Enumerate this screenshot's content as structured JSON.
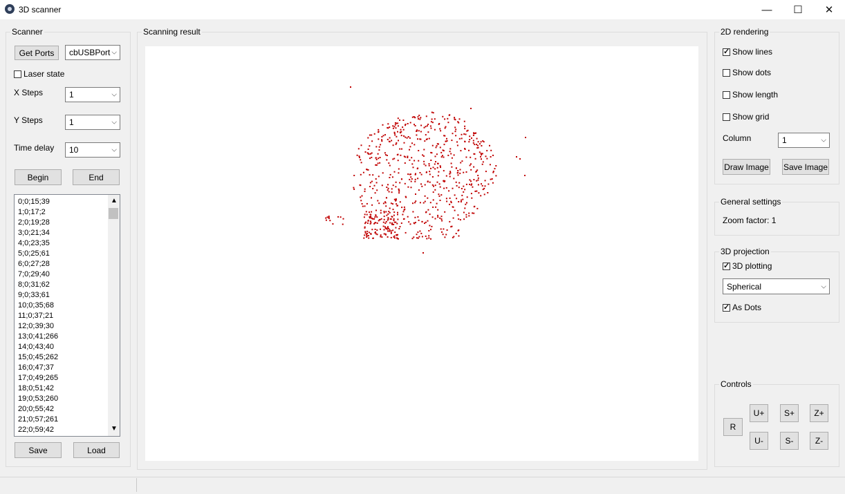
{
  "window": {
    "title": "3D scanner",
    "minimize": "—",
    "maximize": "☐",
    "close": "✕",
    "icon": "paw-icon"
  },
  "scanner": {
    "title": "Scanner",
    "get_ports": "Get Ports",
    "port": "cbUSBPort",
    "laser_state": "Laser state",
    "laser_checked": false,
    "x_steps_label": "X Steps",
    "x_steps": "1",
    "y_steps_label": "Y Steps",
    "y_steps": "1",
    "time_delay_label": "Time delay",
    "time_delay": "10",
    "begin": "Begin",
    "end": "End",
    "save": "Save",
    "load": "Load",
    "items": [
      "0;0;15;39",
      "1;0;17;2",
      "2;0;19;28",
      "3;0;21;34",
      "4;0;23;35",
      "5;0;25;61",
      "6;0;27;28",
      "7;0;29;40",
      "8;0;31;62",
      "9;0;33;61",
      "10;0;35;68",
      "11;0;37;21",
      "12;0;39;30",
      "13;0;41;266",
      "14;0;43;40",
      "15;0;45;262",
      "16;0;47;37",
      "17;0;49;265",
      "18;0;51;42",
      "19;0;53;260",
      "20;0;55;42",
      "21;0;57;261",
      "22;0;59;42"
    ]
  },
  "result": {
    "title": "Scanning result",
    "point_color": "#c00000"
  },
  "rendering2d": {
    "title": "2D rendering",
    "show_lines": "Show lines",
    "show_lines_checked": true,
    "show_dots": "Show dots",
    "show_dots_checked": false,
    "show_length": "Show length",
    "show_length_checked": false,
    "show_grid": "Show grid",
    "show_grid_checked": false,
    "column_label": "Column",
    "column": "1",
    "draw_image": "Draw Image",
    "save_image": "Save Image"
  },
  "general": {
    "title": "General settings",
    "zoom": "Zoom factor: 1"
  },
  "projection": {
    "title": "3D projection",
    "plotting": "3D plotting",
    "plotting_checked": true,
    "mode": "Spherical",
    "as_dots": "As Dots",
    "as_dots_checked": true
  },
  "controls": {
    "title": "Controls",
    "r": "R",
    "u_plus": "U+",
    "u_minus": "U-",
    "s_plus": "S+",
    "s_minus": "S-",
    "z_plus": "Z+",
    "z_minus": "Z-"
  }
}
